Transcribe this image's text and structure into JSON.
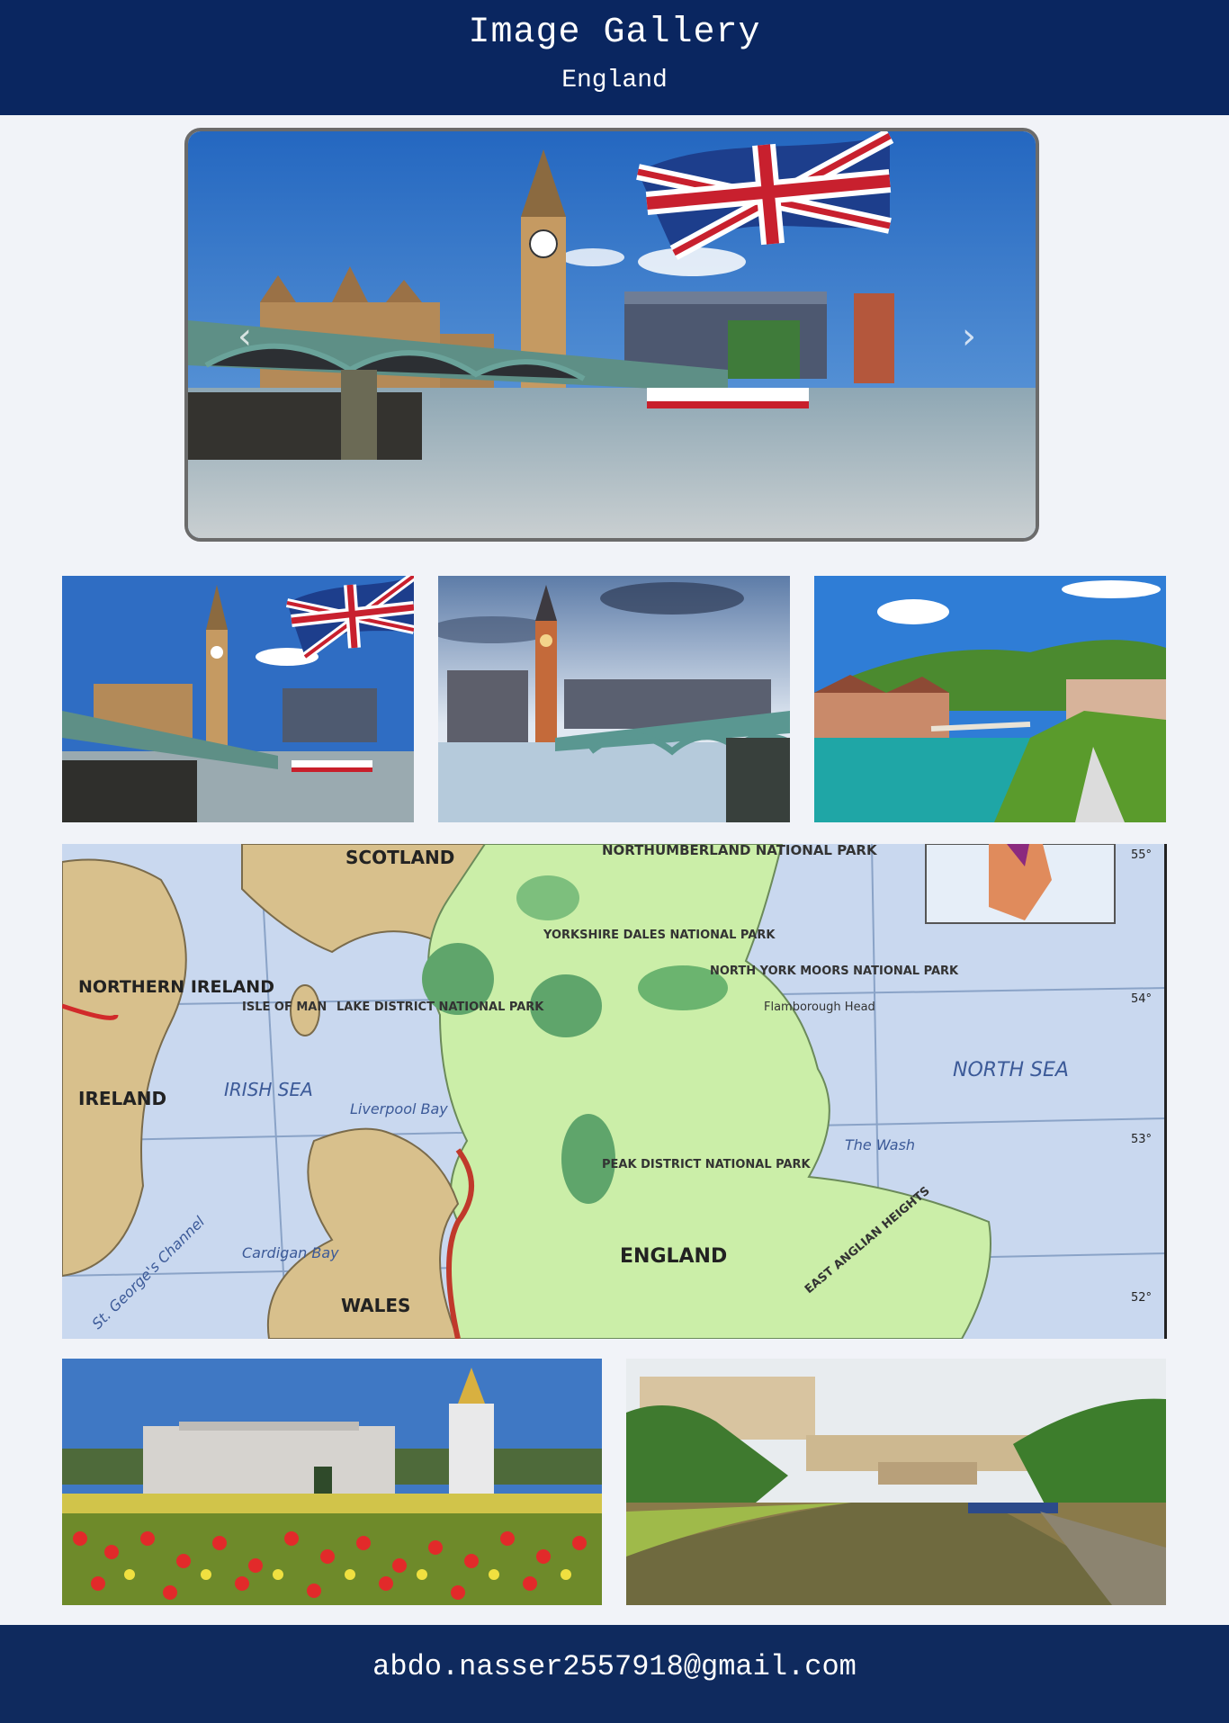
{
  "header": {
    "title": "Image Gallery",
    "subtitle": "England"
  },
  "slider": {
    "prev_icon": "chevron-left-icon",
    "next_icon": "chevron-right-icon",
    "current_image": "london-westminster-union-jack"
  },
  "gallery": {
    "row1": [
      "london-westminster-union-jack",
      "big-ben-westminster-bridge",
      "river-town-green-hills"
    ],
    "map": {
      "labels": [
        "SCOTLAND",
        "NORTHUMBERLAND NATIONAL PARK",
        "NORTHERN IRELAND",
        "IRELAND",
        "IRISH SEA",
        "LAKE DISTRICT NATIONAL PARK",
        "ISLE OF MAN",
        "YORKSHIRE DALES NATIONAL PARK",
        "NORTH YORK MOORS NATIONAL PARK",
        "NORTH SEA",
        "ENGLAND",
        "WALES",
        "Liverpool Bay",
        "Cardigan Bay",
        "The Wash",
        "St. George's Channel",
        "PEAK DISTRICT NATIONAL PARK",
        "EAST ANGLIAN HEIGHTS",
        "Flamborough Head",
        "55°",
        "54°",
        "53°",
        "52°"
      ]
    },
    "row3": [
      "buckingham-palace-tulips",
      "bath-pulteney-bridge-river"
    ]
  },
  "footer": {
    "email": "abdo.nasser2557918@gmail.com"
  },
  "colors": {
    "header_bg": "#0a2660",
    "footer_bg": "#0f2a5e",
    "page_bg": "#f1f3f8"
  }
}
